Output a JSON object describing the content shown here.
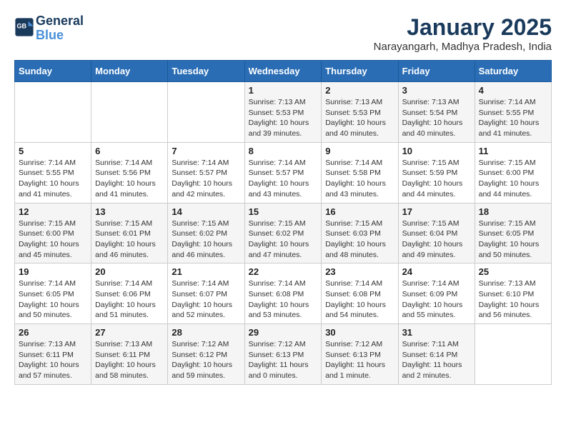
{
  "logo": {
    "line1": "General",
    "line2": "Blue"
  },
  "title": "January 2025",
  "subtitle": "Narayangarh, Madhya Pradesh, India",
  "weekdays": [
    "Sunday",
    "Monday",
    "Tuesday",
    "Wednesday",
    "Thursday",
    "Friday",
    "Saturday"
  ],
  "weeks": [
    [
      {
        "day": "",
        "info": ""
      },
      {
        "day": "",
        "info": ""
      },
      {
        "day": "",
        "info": ""
      },
      {
        "day": "1",
        "info": "Sunrise: 7:13 AM\nSunset: 5:53 PM\nDaylight: 10 hours\nand 39 minutes."
      },
      {
        "day": "2",
        "info": "Sunrise: 7:13 AM\nSunset: 5:53 PM\nDaylight: 10 hours\nand 40 minutes."
      },
      {
        "day": "3",
        "info": "Sunrise: 7:13 AM\nSunset: 5:54 PM\nDaylight: 10 hours\nand 40 minutes."
      },
      {
        "day": "4",
        "info": "Sunrise: 7:14 AM\nSunset: 5:55 PM\nDaylight: 10 hours\nand 41 minutes."
      }
    ],
    [
      {
        "day": "5",
        "info": "Sunrise: 7:14 AM\nSunset: 5:55 PM\nDaylight: 10 hours\nand 41 minutes."
      },
      {
        "day": "6",
        "info": "Sunrise: 7:14 AM\nSunset: 5:56 PM\nDaylight: 10 hours\nand 41 minutes."
      },
      {
        "day": "7",
        "info": "Sunrise: 7:14 AM\nSunset: 5:57 PM\nDaylight: 10 hours\nand 42 minutes."
      },
      {
        "day": "8",
        "info": "Sunrise: 7:14 AM\nSunset: 5:57 PM\nDaylight: 10 hours\nand 43 minutes."
      },
      {
        "day": "9",
        "info": "Sunrise: 7:14 AM\nSunset: 5:58 PM\nDaylight: 10 hours\nand 43 minutes."
      },
      {
        "day": "10",
        "info": "Sunrise: 7:15 AM\nSunset: 5:59 PM\nDaylight: 10 hours\nand 44 minutes."
      },
      {
        "day": "11",
        "info": "Sunrise: 7:15 AM\nSunset: 6:00 PM\nDaylight: 10 hours\nand 44 minutes."
      }
    ],
    [
      {
        "day": "12",
        "info": "Sunrise: 7:15 AM\nSunset: 6:00 PM\nDaylight: 10 hours\nand 45 minutes."
      },
      {
        "day": "13",
        "info": "Sunrise: 7:15 AM\nSunset: 6:01 PM\nDaylight: 10 hours\nand 46 minutes."
      },
      {
        "day": "14",
        "info": "Sunrise: 7:15 AM\nSunset: 6:02 PM\nDaylight: 10 hours\nand 46 minutes."
      },
      {
        "day": "15",
        "info": "Sunrise: 7:15 AM\nSunset: 6:02 PM\nDaylight: 10 hours\nand 47 minutes."
      },
      {
        "day": "16",
        "info": "Sunrise: 7:15 AM\nSunset: 6:03 PM\nDaylight: 10 hours\nand 48 minutes."
      },
      {
        "day": "17",
        "info": "Sunrise: 7:15 AM\nSunset: 6:04 PM\nDaylight: 10 hours\nand 49 minutes."
      },
      {
        "day": "18",
        "info": "Sunrise: 7:15 AM\nSunset: 6:05 PM\nDaylight: 10 hours\nand 50 minutes."
      }
    ],
    [
      {
        "day": "19",
        "info": "Sunrise: 7:14 AM\nSunset: 6:05 PM\nDaylight: 10 hours\nand 50 minutes."
      },
      {
        "day": "20",
        "info": "Sunrise: 7:14 AM\nSunset: 6:06 PM\nDaylight: 10 hours\nand 51 minutes."
      },
      {
        "day": "21",
        "info": "Sunrise: 7:14 AM\nSunset: 6:07 PM\nDaylight: 10 hours\nand 52 minutes."
      },
      {
        "day": "22",
        "info": "Sunrise: 7:14 AM\nSunset: 6:08 PM\nDaylight: 10 hours\nand 53 minutes."
      },
      {
        "day": "23",
        "info": "Sunrise: 7:14 AM\nSunset: 6:08 PM\nDaylight: 10 hours\nand 54 minutes."
      },
      {
        "day": "24",
        "info": "Sunrise: 7:14 AM\nSunset: 6:09 PM\nDaylight: 10 hours\nand 55 minutes."
      },
      {
        "day": "25",
        "info": "Sunrise: 7:13 AM\nSunset: 6:10 PM\nDaylight: 10 hours\nand 56 minutes."
      }
    ],
    [
      {
        "day": "26",
        "info": "Sunrise: 7:13 AM\nSunset: 6:11 PM\nDaylight: 10 hours\nand 57 minutes."
      },
      {
        "day": "27",
        "info": "Sunrise: 7:13 AM\nSunset: 6:11 PM\nDaylight: 10 hours\nand 58 minutes."
      },
      {
        "day": "28",
        "info": "Sunrise: 7:12 AM\nSunset: 6:12 PM\nDaylight: 10 hours\nand 59 minutes."
      },
      {
        "day": "29",
        "info": "Sunrise: 7:12 AM\nSunset: 6:13 PM\nDaylight: 11 hours\nand 0 minutes."
      },
      {
        "day": "30",
        "info": "Sunrise: 7:12 AM\nSunset: 6:13 PM\nDaylight: 11 hours\nand 1 minute."
      },
      {
        "day": "31",
        "info": "Sunrise: 7:11 AM\nSunset: 6:14 PM\nDaylight: 11 hours\nand 2 minutes."
      },
      {
        "day": "",
        "info": ""
      }
    ]
  ]
}
